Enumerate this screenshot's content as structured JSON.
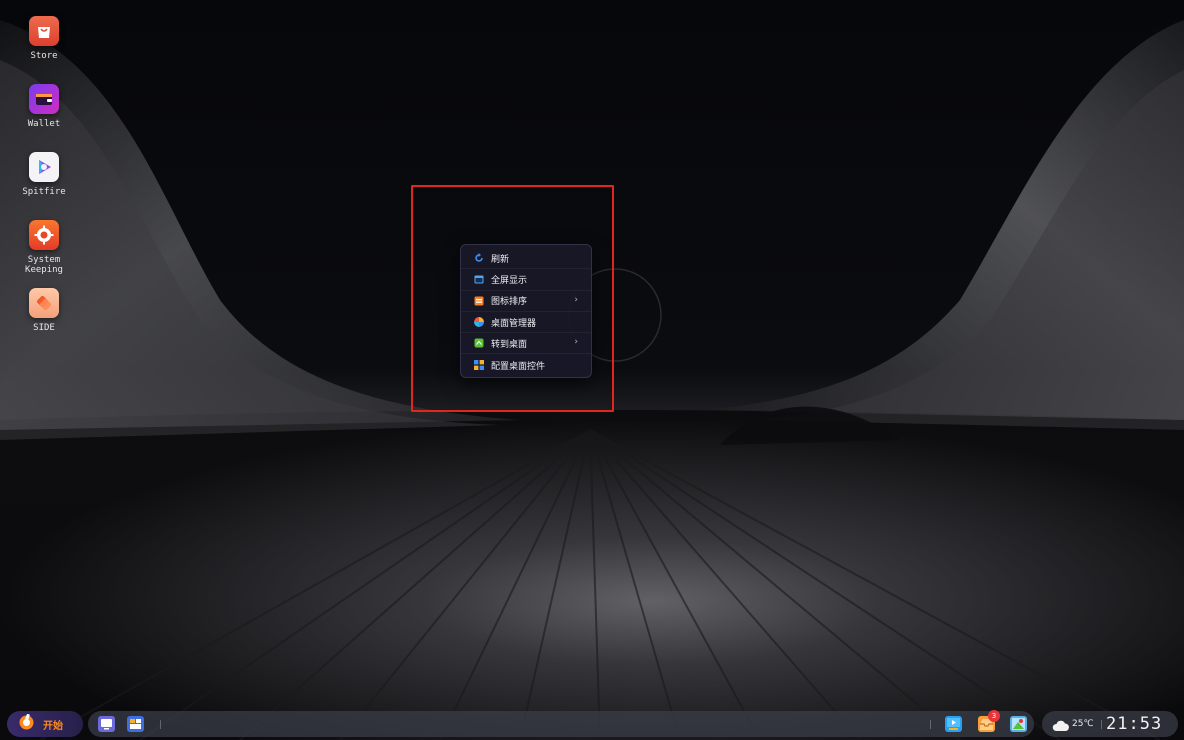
{
  "desktop_icons": [
    {
      "label": "Store",
      "icon": "store-bag-icon",
      "color": "#e8553c"
    },
    {
      "label": "Wallet",
      "icon": "wallet-icon",
      "color": "#a035d8"
    },
    {
      "label": "Spitfire",
      "icon": "spitfire-play-icon",
      "color": "#f2f2f2"
    },
    {
      "label": "System\nKeeping",
      "icon": "gear-icon",
      "color": "#f05a2a"
    },
    {
      "label": "SIDE",
      "icon": "side-layers-icon",
      "color": "#f47a4a"
    }
  ],
  "context_menu": {
    "items": [
      {
        "label": "刷新",
        "icon": "refresh-icon",
        "has_submenu": false
      },
      {
        "label": "全屏显示",
        "icon": "fullscreen-icon",
        "has_submenu": false
      },
      {
        "label": "图标排序",
        "icon": "sort-icon",
        "has_submenu": true
      },
      {
        "label": "桌面管理器",
        "icon": "desktop-manager-icon",
        "has_submenu": false
      },
      {
        "label": "转到桌面",
        "icon": "switch-desktop-icon",
        "has_submenu": true
      },
      {
        "label": "配置桌面控件",
        "icon": "widgets-icon",
        "has_submenu": false
      }
    ],
    "submenu_glyph": "›"
  },
  "taskbar": {
    "start_label": "开始",
    "notification_count": "3",
    "weather_temp": "25℃",
    "clock": "21:53"
  },
  "colors": {
    "highlight": "#e0261d",
    "start_accent": "#ff8a1f"
  }
}
